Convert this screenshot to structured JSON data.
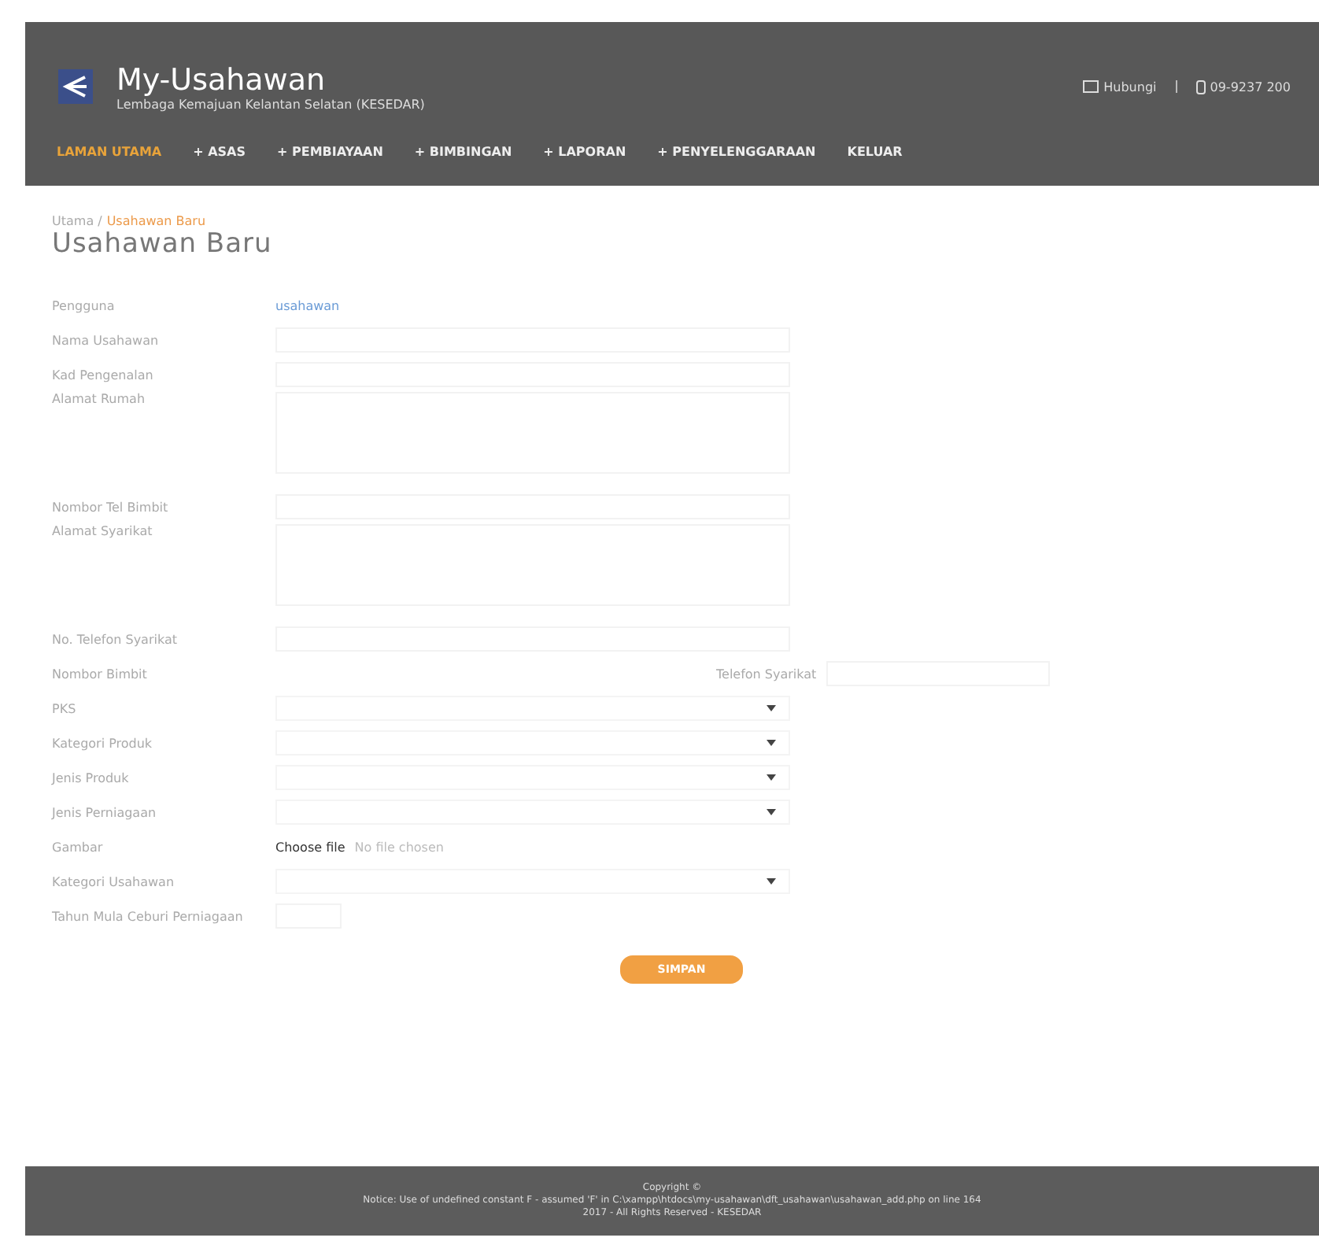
{
  "header": {
    "title": "My-Usahawan",
    "subtitle": "Lembaga Kemajuan Kelantan Selatan (KESEDAR)",
    "contact": [
      {
        "kind": "mail",
        "text": "Hubungi"
      },
      {
        "kind": "phone",
        "text": "09-9237 200"
      }
    ]
  },
  "nav": [
    {
      "label": "LAMAN UTAMA",
      "selected": true
    },
    {
      "label": "+ ASAS",
      "selected": false
    },
    {
      "label": "+ PEMBIAYAAN",
      "selected": false
    },
    {
      "label": "+ BIMBINGAN",
      "selected": false
    },
    {
      "label": "+ LAPORAN",
      "selected": false
    },
    {
      "label": "+ PENYELENGGARAAN",
      "selected": false
    },
    {
      "label": "KELUAR",
      "selected": false
    }
  ],
  "breadcrumb": [
    {
      "text": "Utama /"
    },
    {
      "text": "Usahawan Baru"
    }
  ],
  "page_title": "Usahawan Baru",
  "form": [
    {
      "kind": "value",
      "label": "Pengguna",
      "value": "usahawan"
    },
    {
      "kind": "text",
      "label": "Nama Usahawan"
    },
    {
      "kind": "text",
      "label": "Kad Pengenalan"
    },
    {
      "kind": "textarea",
      "label": "Alamat Rumah"
    },
    {
      "kind": "text",
      "label": "Nombor Tel Bimbit"
    },
    {
      "kind": "textarea",
      "label": "Alamat Syarikat"
    },
    {
      "kind": "text",
      "label": "No. Telefon Syarikat"
    },
    {
      "kind": "pair",
      "label": "Nombor Bimbit",
      "second_label": "Telefon Syarikat"
    },
    {
      "kind": "select",
      "label": "PKS"
    },
    {
      "kind": "select",
      "label": "Kategori Produk"
    },
    {
      "kind": "select",
      "label": "Jenis Produk"
    },
    {
      "kind": "select",
      "label": "Jenis Perniagaan"
    },
    {
      "kind": "file",
      "label": "Gambar",
      "button": "Choose file",
      "note": "No file chosen"
    },
    {
      "kind": "select",
      "label": "Kategori Usahawan"
    },
    {
      "kind": "small",
      "label": "Tahun Mula Ceburi Perniagaan"
    }
  ],
  "submit": "SIMPAN",
  "footer": [
    "Copyright ©",
    "Notice: Use of undefined constant F - assumed 'F' in C:\\xampp\\htdocs\\my-usahawan\\dft_usahawan\\usahawan_add.php on line 164",
    "2017 - All Rights Reserved - KESEDAR"
  ]
}
